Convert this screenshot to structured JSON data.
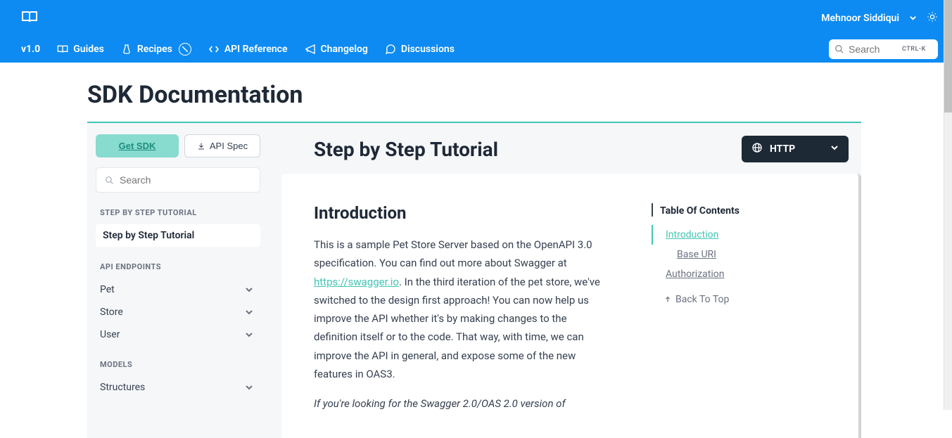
{
  "topbar": {
    "user_name": "Mehnoor Siddiqui"
  },
  "navbar": {
    "version": "v1.0",
    "items": [
      "Guides",
      "Recipes",
      "API Reference",
      "Changelog",
      "Discussions"
    ],
    "search_placeholder": "Search",
    "search_hint": "CTRL-K"
  },
  "page": {
    "title": "SDK Documentation"
  },
  "sidebar": {
    "get_sdk_label": "Get SDK",
    "api_spec_label": "API Spec",
    "search_placeholder": "Search",
    "sections": [
      {
        "title": "STEP BY STEP TUTORIAL",
        "items": [
          {
            "label": "Step by Step Tutorial",
            "active": true,
            "expandable": false
          }
        ]
      },
      {
        "title": "API ENDPOINTS",
        "items": [
          {
            "label": "Pet",
            "expandable": true
          },
          {
            "label": "Store",
            "expandable": true
          },
          {
            "label": "User",
            "expandable": true
          }
        ]
      },
      {
        "title": "MODELS",
        "items": [
          {
            "label": "Structures",
            "expandable": true
          }
        ]
      }
    ]
  },
  "content": {
    "header_title": "Step by Step Tutorial",
    "http_label": "HTTP",
    "intro_heading": "Introduction",
    "intro_p1a": "This is a sample Pet Store Server based on the OpenAPI 3.0 specification. You can find out more about Swagger at ",
    "intro_link": "https://swagger.io",
    "intro_p1b": ". In the third iteration of the pet store, we've switched to the design first approach! You can now help us improve the API whether it's by making changes to the definition itself or to the code. That way, with time, we can improve the API in general, and expose some of the new features in OAS3.",
    "intro_p2": "If you're looking for the Swagger 2.0/OAS 2.0 version of"
  },
  "toc": {
    "title": "Table Of Contents",
    "items": [
      {
        "label": "Introduction",
        "type": "active"
      },
      {
        "label": "Base URI",
        "type": "sub"
      },
      {
        "label": "Authorization",
        "type": "plain"
      }
    ],
    "back_to_top": "Back To Top"
  }
}
